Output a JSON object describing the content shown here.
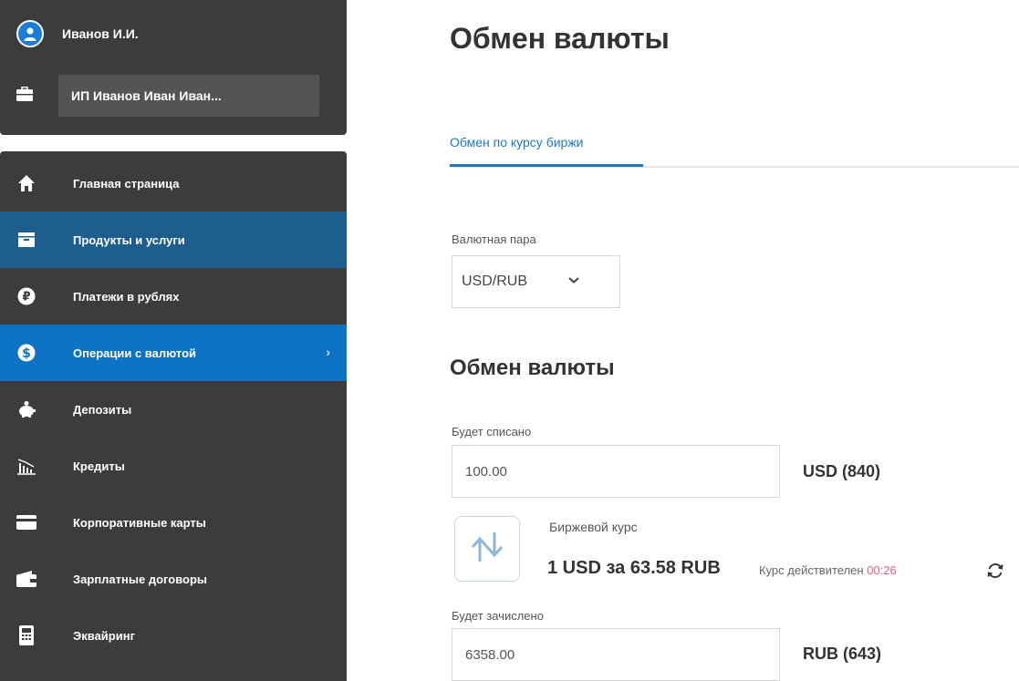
{
  "user": {
    "name": "Иванов И.И.",
    "company": "ИП Иванов Иван Иван..."
  },
  "menu": [
    {
      "label": "Главная страница",
      "icon": "home-icon",
      "state": "normal"
    },
    {
      "label": "Продукты и услуги",
      "icon": "archive-box-icon",
      "state": "highlight"
    },
    {
      "label": "Платежи в рублях",
      "icon": "ruble-icon",
      "state": "normal"
    },
    {
      "label": "Операции с валютой",
      "icon": "dollar-icon",
      "state": "active",
      "chevron": "›"
    },
    {
      "label": "Депозиты",
      "icon": "piggy-bank-icon",
      "state": "normal"
    },
    {
      "label": "Кредиты",
      "icon": "bar-chart-icon",
      "state": "normal"
    },
    {
      "label": "Корпоративные карты",
      "icon": "card-icon",
      "state": "normal"
    },
    {
      "label": "Зарплатные договоры",
      "icon": "wallet-icon",
      "state": "normal"
    },
    {
      "label": "Эквайринг",
      "icon": "pos-terminal-icon",
      "state": "normal"
    }
  ],
  "page": {
    "title": "Обмен валюты"
  },
  "tabs": [
    {
      "label": "Обмен по курсу биржи",
      "active": true
    }
  ],
  "pair": {
    "label": "Валютная пара",
    "value": "USD/RUB"
  },
  "exchange": {
    "title": "Обмен валюты",
    "debit_label": "Будет списано",
    "debit_value": "100.00",
    "debit_currency": "USD (840)",
    "rate_label": "Биржевой курс",
    "rate_value": "1 USD за 63.58 RUB",
    "rate_valid_label": "Курс действителен",
    "rate_timer": "00:26",
    "credit_label": "Будет зачислено",
    "credit_value": "6358.00",
    "credit_currency": "RUB (643)"
  },
  "colors": {
    "active": "#0f73c5",
    "highlight": "#1d5e8f",
    "sidebar": "#3c3c3c",
    "accent_text": "#1e78c8",
    "timer": "#e0627a"
  }
}
